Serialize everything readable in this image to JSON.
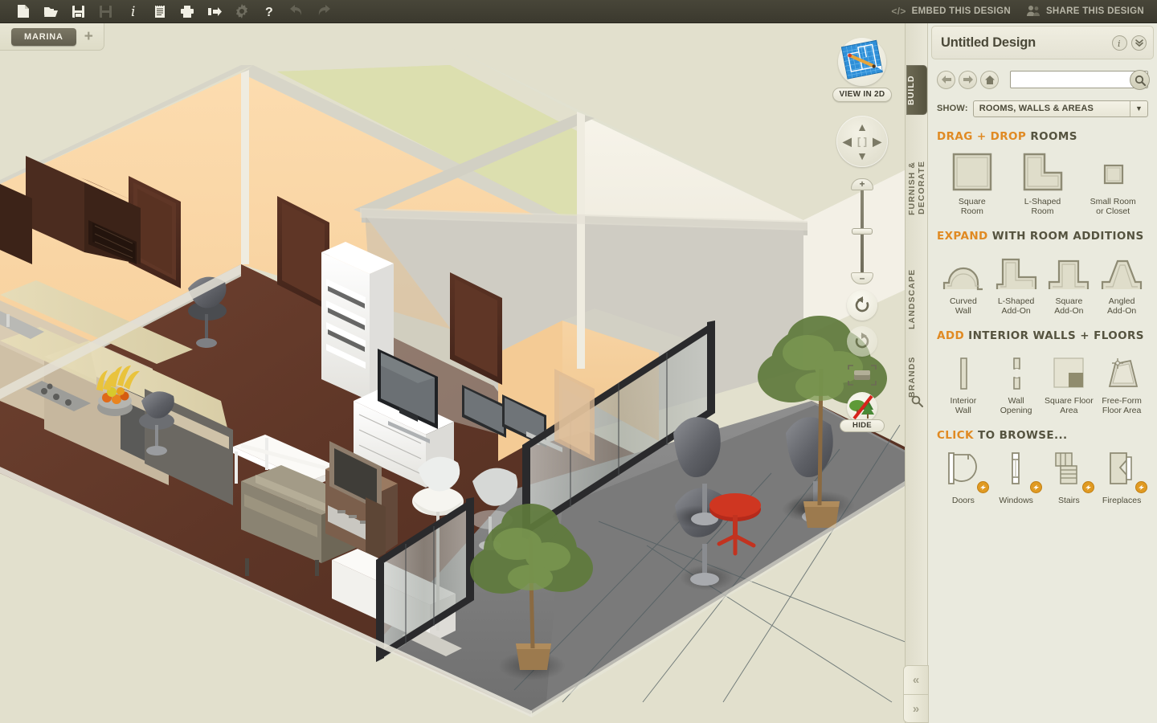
{
  "app": {
    "background_color": "#e2e0cd",
    "panel_color": "#eaeade",
    "accent_color": "#e08a23",
    "toolbar_color": "#3f3d31"
  },
  "toolbar": {
    "buttons": [
      {
        "name": "new-document-icon",
        "title": "New"
      },
      {
        "name": "open-folder-icon",
        "title": "Open"
      },
      {
        "name": "save-icon",
        "title": "Save"
      },
      {
        "name": "save-as-icon",
        "title": "Save As"
      },
      {
        "name": "info-icon",
        "title": "Info"
      },
      {
        "name": "notes-icon",
        "title": "Notes"
      },
      {
        "name": "print-icon",
        "title": "Print"
      },
      {
        "name": "export-icon",
        "title": "Export"
      },
      {
        "name": "settings-gear-icon",
        "title": "Settings"
      },
      {
        "name": "help-icon",
        "title": "Help"
      },
      {
        "name": "undo-icon",
        "title": "Undo"
      },
      {
        "name": "redo-icon",
        "title": "Redo"
      }
    ],
    "embed_label": "EMBED THIS DESIGN",
    "embed_glyph": "</>",
    "share_label": "SHARE THIS DESIGN"
  },
  "tabstrip": {
    "tabs": [
      {
        "label": "MARINA",
        "active": true
      }
    ],
    "add_label": "+"
  },
  "viewport": {
    "view_2d_label": "VIEW IN 2D",
    "pan_up": "▲",
    "pan_down": "▼",
    "pan_left": "◀",
    "pan_right": "▶",
    "pan_center": "[ ]",
    "zoom_in": "+",
    "zoom_out": "–",
    "rotate_left_name": "rotate-left-icon",
    "rotate_right_name": "rotate-right-icon",
    "fit_to_frame_name": "fit-to-frame-icon",
    "hide_label": "HIDE"
  },
  "vertical_tabs": [
    {
      "label": "BUILD",
      "active": true
    },
    {
      "label": "FURNISH & DECORATE",
      "active": false
    },
    {
      "label": "LANDSCAPE",
      "active": false
    },
    {
      "label": "BRANDS",
      "active": false
    }
  ],
  "panel": {
    "title": "Untitled Design",
    "info_glyph": "i",
    "collapse_glyph": "»",
    "nav": {
      "back_glyph": "←",
      "forward_glyph": "→",
      "home_name": "home-icon"
    },
    "search": {
      "value": "",
      "placeholder": ""
    },
    "show": {
      "label": "SHOW:",
      "selected": "ROOMS, WALLS & AREAS",
      "options": [
        "ROOMS, WALLS & AREAS"
      ]
    },
    "sections": [
      {
        "id": "drag-drop-rooms",
        "title_highlight": "DRAG + DROP",
        "title_rest": "ROOMS",
        "items": [
          {
            "label": "Square\nRoom",
            "label_line1": "Square",
            "label_line2": "Room",
            "icon": "square-room-icon"
          },
          {
            "label": "L-Shaped Room",
            "label_line1": "L-Shaped",
            "label_line2": "Room",
            "icon": "l-shaped-room-icon"
          },
          {
            "label": "Small Room or Closet",
            "label_line1": "Small Room",
            "label_line2": "or Closet",
            "icon": "small-room-icon"
          }
        ]
      },
      {
        "id": "room-additions",
        "title_highlight": "EXPAND",
        "title_rest": "WITH ROOM ADDITIONS",
        "items": [
          {
            "label_line1": "Curved",
            "label_line2": "Wall",
            "icon": "curved-wall-icon"
          },
          {
            "label_line1": "L-Shaped",
            "label_line2": "Add-On",
            "icon": "l-shaped-addon-icon"
          },
          {
            "label_line1": "Square",
            "label_line2": "Add-On",
            "icon": "square-addon-icon"
          },
          {
            "label_line1": "Angled",
            "label_line2": "Add-On",
            "icon": "angled-addon-icon"
          }
        ]
      },
      {
        "id": "interior-walls-floors",
        "title_highlight": "ADD",
        "title_rest": "INTERIOR WALLS + FLOORS",
        "items": [
          {
            "label_line1": "Interior",
            "label_line2": "Wall",
            "icon": "interior-wall-icon"
          },
          {
            "label_line1": "Wall",
            "label_line2": "Opening",
            "icon": "wall-opening-icon"
          },
          {
            "label_line1": "Square Floor",
            "label_line2": "Area",
            "icon": "square-floor-area-icon"
          },
          {
            "label_line1": "Free-Form",
            "label_line2": "Floor Area",
            "icon": "free-form-floor-area-icon"
          }
        ]
      },
      {
        "id": "click-to-browse",
        "title_highlight": "CLICK",
        "title_rest": "TO BROWSE...",
        "items": [
          {
            "label_line1": "Doors",
            "label_line2": "",
            "icon": "door-icon"
          },
          {
            "label_line1": "Windows",
            "label_line2": "",
            "icon": "window-icon"
          },
          {
            "label_line1": "Stairs",
            "label_line2": "",
            "icon": "stairs-icon"
          },
          {
            "label_line1": "Fireplaces",
            "label_line2": "",
            "icon": "fireplace-icon"
          }
        ]
      }
    ]
  },
  "collapse": {
    "left_glyph": "«",
    "right_glyph": "»"
  }
}
